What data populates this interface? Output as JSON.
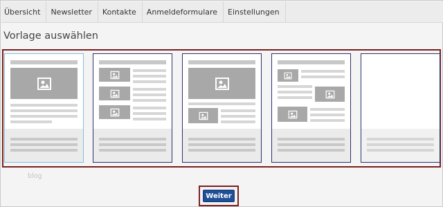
{
  "nav": {
    "items": [
      {
        "label": "Übersicht"
      },
      {
        "label": "Newsletter"
      },
      {
        "label": "Kontakte"
      },
      {
        "label": "Anmeldeformulare"
      },
      {
        "label": "Einstellungen"
      }
    ]
  },
  "page": {
    "title": "Vorlage auswählen"
  },
  "templates": {
    "selected_label": "blog",
    "items": [
      {
        "layout": "image-top",
        "selected": true
      },
      {
        "layout": "image-left-list",
        "selected": false
      },
      {
        "layout": "image-top-small-left",
        "selected": false
      },
      {
        "layout": "alternating",
        "selected": false
      },
      {
        "layout": "blank",
        "selected": false
      }
    ]
  },
  "actions": {
    "next_label": "Weiter"
  },
  "colors": {
    "highlight_border": "#7a1f1f",
    "button_bg": "#1f4f96",
    "selected_border": "#7ec0da"
  }
}
